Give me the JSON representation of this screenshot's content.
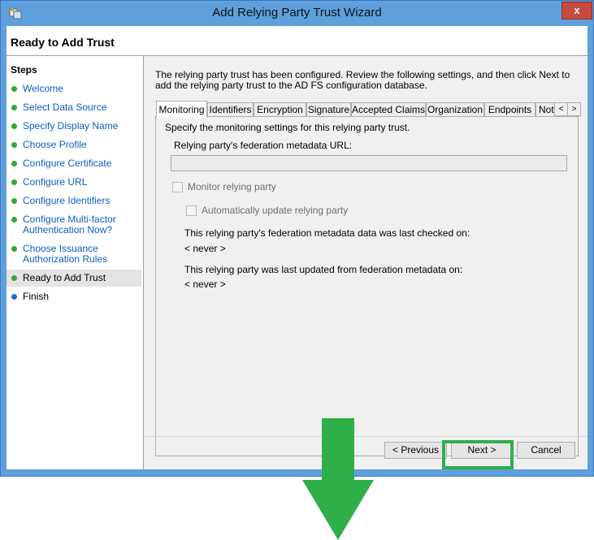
{
  "window": {
    "title": "Add Relying Party Trust Wizard",
    "close_glyph": "x"
  },
  "header": {
    "title": "Ready to Add Trust"
  },
  "steps": {
    "title": "Steps",
    "items": [
      {
        "label": "Welcome"
      },
      {
        "label": "Select Data Source"
      },
      {
        "label": "Specify Display Name"
      },
      {
        "label": "Choose Profile"
      },
      {
        "label": "Configure Certificate"
      },
      {
        "label": "Configure URL"
      },
      {
        "label": "Configure Identifiers"
      },
      {
        "label": "Configure Multi-factor Authentication Now?"
      },
      {
        "label": "Choose Issuance Authorization Rules"
      },
      {
        "label": "Ready to Add Trust"
      },
      {
        "label": "Finish"
      }
    ]
  },
  "intro": "The relying party trust has been configured. Review the following settings, and then click Next to add the relying party trust to the AD FS configuration database.",
  "tabs": [
    {
      "label": "Monitoring"
    },
    {
      "label": "Identifiers"
    },
    {
      "label": "Encryption"
    },
    {
      "label": "Signature"
    },
    {
      "label": "Accepted Claims"
    },
    {
      "label": "Organization"
    },
    {
      "label": "Endpoints"
    },
    {
      "label": "Note"
    }
  ],
  "tab_arrows": {
    "left": "<",
    "right": ">"
  },
  "monitoring": {
    "description": "Specify the monitoring settings for this relying party trust.",
    "metadata_url_label": "Relying party's federation metadata URL:",
    "metadata_url_value": "",
    "monitor_label": "Monitor relying party",
    "auto_update_label": "Automatically update relying party",
    "last_checked_label": "This relying party's federation metadata data was last checked on:",
    "last_checked_value": "< never >",
    "last_updated_label": "This relying party was last updated from federation metadata on:",
    "last_updated_value": "< never >"
  },
  "buttons": {
    "previous": "< Previous",
    "next": "Next >",
    "cancel": "Cancel"
  },
  "colors": {
    "titlebar": "#5fa0dc",
    "highlight": "#2faf4a",
    "arrow": "#2faf4a",
    "step_link": "#0b5fbf"
  }
}
